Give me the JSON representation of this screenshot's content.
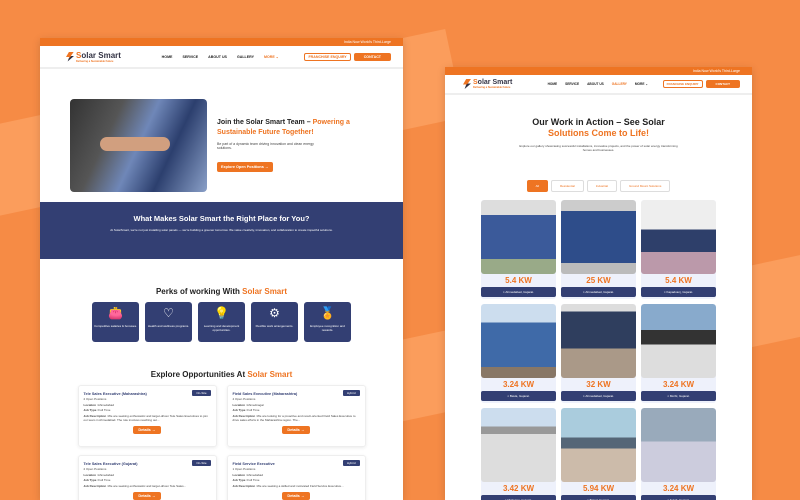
{
  "brand": {
    "name_a": "S",
    "name_b": "olar Smart",
    "tagline": "Delivering a Sustainable Future"
  },
  "topbar": "India Now World's Third-Large",
  "nav": {
    "items": [
      "HOME",
      "SERVICE",
      "ABOUT US",
      "GALLERY",
      "MORE"
    ],
    "franchise": "FRANCHISE ENQUIRY",
    "contact": "CONTACT"
  },
  "careers": {
    "hero_title_a": "Join the Solar Smart Team – ",
    "hero_title_b": "Powering a Sustainable Future Together!",
    "hero_text": "Be part of a dynamic team driving innovation and clean energy solutions.",
    "hero_button": "Explore Open Positions →",
    "why_title": "What Makes Solar Smart the Right Place for You?",
    "why_text": "At SolarSmart, we're not just installing solar panels — we're building a greener tomorrow. We value creativity, innovation, and collaboration to create impactful solutions.",
    "perks_title_a": "Perks of working With ",
    "perks_title_b": "Solar Smart",
    "perks": [
      {
        "icon": "wallet-icon",
        "glyph": "👛",
        "label": "Competitive salaries & bonuses."
      },
      {
        "icon": "heart-pulse-icon",
        "glyph": "♡",
        "label": "Health and wellness programs."
      },
      {
        "icon": "lightbulb-book-icon",
        "glyph": "💡",
        "label": "Learning and development opportunities."
      },
      {
        "icon": "gear-arrows-icon",
        "glyph": "⚙",
        "label": "Flexible work arrangements."
      },
      {
        "icon": "award-icon",
        "glyph": "🏅",
        "label": "Employee recognition and rewards."
      }
    ],
    "jobs_title_a": "Explore Opportunities At ",
    "jobs_title_b": "Solar Smart",
    "jobs": [
      {
        "title": "Tele Sales Executive (Maharashtra)",
        "badge": "On-Site",
        "openings": "2 Open Positions",
        "location": "Ahmedabad",
        "type": "Full Time",
        "desc": "We are seeking enthusiastic and target-driven Tele Sales Executives to join our team in Ahmedabad. The role involves reaching out...",
        "button": "Details →"
      },
      {
        "title": "Field Sales Executive (Maharashtra)",
        "badge": "Hybrid",
        "openings": "4 Open Positions",
        "location": "Ahmednagar",
        "type": "Full Time",
        "desc": "We are looking for a proactive and result-oriented Field Sales Executive to drive sales efforts in the Maharashtra region. The...",
        "button": "Details →"
      },
      {
        "title": "Tele Sales Executive (Gujarat)",
        "badge": "On-Site",
        "openings": "2 Open Positions",
        "location": "Ahmedabad",
        "type": "Full Time",
        "desc": "We are seeking enthusiastic and target-driven Tele Sales...",
        "button": "Details →"
      },
      {
        "title": "Field Service Executive",
        "badge": "Hybrid",
        "openings": "1 Open Positions",
        "location": "Ahmedabad",
        "type": "Full Time",
        "desc": "We are seeking a skilled and motivated Field Service Executive...",
        "button": "Details →"
      }
    ],
    "labels": {
      "location": "Location :",
      "type": "Job Type :",
      "desc": "Job Description :"
    }
  },
  "gallery": {
    "title_a": "Our Work in Action – See Solar",
    "title_b": "Solutions Come to Life!",
    "text": "Explore our gallery showcasing successful installations, innovative projects, and the power of solar energy transforming homes and businesses.",
    "filters": [
      "All",
      "Residential",
      "Industrial",
      "Ground Mount Solutions"
    ],
    "items": [
      {
        "kw": "5.4 KW",
        "loc": "Ahmedabad, Gujarat."
      },
      {
        "kw": "25 KW",
        "loc": "Ahmedabad, Gujarat."
      },
      {
        "kw": "5.4 KW",
        "loc": "Kapadvanj, Gujarat."
      },
      {
        "kw": "3.24 KW",
        "loc": "Bavla, Gujarat."
      },
      {
        "kw": "32 KW",
        "loc": "Ahmedabad, Gujarat."
      },
      {
        "kw": "3.24 KW",
        "loc": "Morbi, Gujarat."
      },
      {
        "kw": "3.42 KW",
        "loc": "Mehsana, Gujarat."
      },
      {
        "kw": "5.94 KW",
        "loc": "Botad, Gujarat."
      },
      {
        "kw": "3.24 KW",
        "loc": "Kutch, Gujarat."
      }
    ]
  }
}
